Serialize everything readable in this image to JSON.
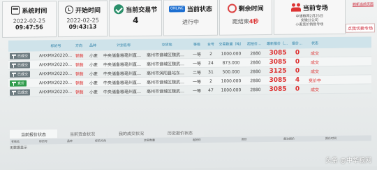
{
  "header": {
    "system_time": {
      "label": "系统时间",
      "date": "2022-02-25",
      "time": "09:47:56"
    },
    "start_time": {
      "label": "开始时间",
      "date": "2022-02-25",
      "time": "09:43:13"
    },
    "current_lot": {
      "label": "当前交易节",
      "value": "4"
    },
    "current_status": {
      "chip": "ONLINE",
      "label": "当前状态",
      "value": "进行中"
    },
    "remaining": {
      "label": "剩余时间",
      "value_prefix": "距结束",
      "value_red": "4秒"
    },
    "current_session": {
      "label": "当前专场",
      "line1": "中储粮网2月25日",
      "line2": "安徽分公司",
      "line3": "小麦竞价销售专场"
    },
    "refresh_link": "刷新当前页面",
    "switch_button": "点我切换专场"
  },
  "table": {
    "columns": [
      "",
      "标的号",
      "方向",
      "品种",
      "计划名称",
      "交货地",
      "等级",
      "台号",
      "交易数量（吨）",
      "起拍价（元/吨）",
      "最新报价（元/吨）",
      "报价次数",
      "状态"
    ],
    "rows": [
      {
        "state": "已成交",
        "lot": "AHXMX202202250016",
        "dir": "销售",
        "type": "小麦",
        "plan": "中央储备粮亳州直属库...",
        "place": "亳州市谯城区魏武大道...",
        "grade": "一等",
        "seat": "2",
        "qty": "1000.000",
        "start": "2880",
        "price": "3085",
        "count": "0",
        "status": "成交"
      },
      {
        "state": "已成交",
        "lot": "AHXMX202202250017",
        "dir": "销售",
        "type": "小麦",
        "plan": "中央储备粮亳州直属库...",
        "place": "亳州市谯城区魏武大道...",
        "grade": "一等",
        "seat": "24",
        "qty": "873.000",
        "start": "2880",
        "price": "3085",
        "count": "0",
        "status": "成交"
      },
      {
        "state": "已成交",
        "lot": "AHXMX202202250018",
        "dir": "销售",
        "type": "小麦",
        "plan": "中央储备粮亳州直属库...",
        "place": "亳州市涡阳县站东路...",
        "grade": "二等",
        "seat": "31",
        "qty": "500.000",
        "start": "2880",
        "price": "3125",
        "count": "0",
        "status": "成交"
      },
      {
        "state": "竞价",
        "lot": "AHXMX202202250019",
        "dir": "销售",
        "type": "小麦",
        "plan": "中央储备粮亳州直属库...",
        "place": "亳州市谯城区魏武大道...",
        "grade": "一等",
        "seat": "2",
        "qty": "1000.000",
        "start": "2880",
        "price": "3085",
        "count": "4",
        "status": "竞价中"
      },
      {
        "state": "已成交",
        "lot": "AHXMX202202250020",
        "dir": "销售",
        "type": "小麦",
        "plan": "中央储备粮亳州直属库...",
        "place": "亳州市谯城区魏武大道...",
        "grade": "一等",
        "seat": "47",
        "qty": "1000.000",
        "start": "2880",
        "price": "3085",
        "count": "0",
        "status": "成交"
      }
    ]
  },
  "tabs": [
    "当前报价状态",
    "当前资金状况",
    "我的成交状况",
    "历史报价状态"
  ],
  "subhead": [
    "考核名",
    "标的号",
    "品种",
    "标的方向",
    "交易数量",
    "起拍价",
    "报价",
    "首次报价",
    "报价时间"
  ],
  "empty_text": "无数据显示",
  "watermark": "头条 @中华粮网"
}
